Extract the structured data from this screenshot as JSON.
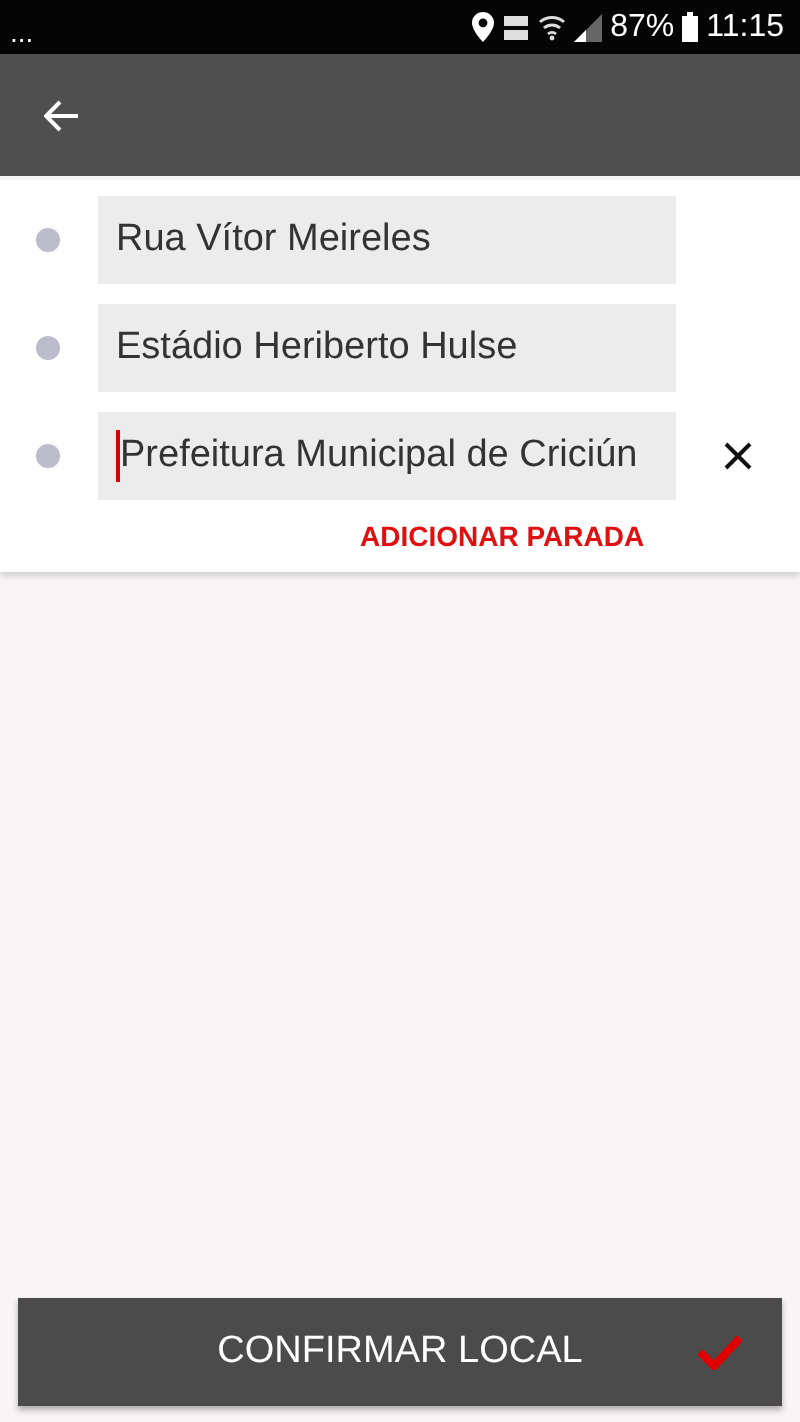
{
  "status_bar": {
    "notifications": "...",
    "battery": "87%",
    "time": "11:15"
  },
  "stops": [
    {
      "value": "Rua Vítor Meireles",
      "focused": false,
      "removable": false
    },
    {
      "value": "Estádio Heriberto Hulse",
      "focused": false,
      "removable": false
    },
    {
      "value": "Prefeitura Municipal de Criciún",
      "focused": true,
      "removable": true
    }
  ],
  "add_stop": "ADICIONAR PARADA",
  "confirm_button": "CONFIRMAR LOCAL"
}
